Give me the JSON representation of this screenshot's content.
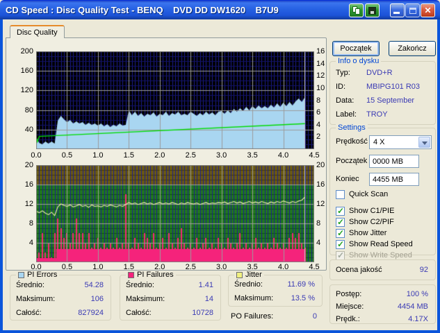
{
  "window": {
    "title": "CD Speed : Disc Quality Test - BENQ    DVD DD DW1620    B7U9"
  },
  "titlebar_icons": {
    "copy": "copy-icon",
    "save": "save-icon",
    "minimize": "minimize-icon",
    "maximize": "maximize-icon",
    "close": "close-icon"
  },
  "tab": {
    "label": "Disc Quality"
  },
  "actions": {
    "start_label": "Początek",
    "stop_label": "Zakończ"
  },
  "disc_info": {
    "title": "Info o dysku",
    "rows": [
      {
        "label": "Typ:",
        "value": "DVD+R"
      },
      {
        "label": "ID:",
        "value": "MBIPG101 R03"
      },
      {
        "label": "Data:",
        "value": "15 September"
      },
      {
        "label": "Label:",
        "value": "TROY"
      }
    ]
  },
  "settings": {
    "title": "Settings",
    "speed_label": "Prędkość",
    "speed_value": "4 X",
    "start_label": "Początek",
    "start_value": "0000 MB",
    "end_label": "Koniec",
    "end_value": "4455 MB",
    "checkboxes": [
      {
        "label": "Quick Scan",
        "checked": false,
        "enabled": true
      },
      {
        "label": "Show C1/PIE",
        "checked": true,
        "enabled": true
      },
      {
        "label": "Show C2/PIF",
        "checked": true,
        "enabled": true
      },
      {
        "label": "Show Jitter",
        "checked": true,
        "enabled": true
      },
      {
        "label": "Show Read Speed",
        "checked": true,
        "enabled": true
      },
      {
        "label": "Show Write Speed",
        "checked": true,
        "enabled": false
      }
    ]
  },
  "quality": {
    "label": "Ocena jakość",
    "value": "92"
  },
  "progress": {
    "rows": [
      {
        "label": "Postęp:",
        "value": "100 %"
      },
      {
        "label": "Miejsce:",
        "value": "4454 MB"
      },
      {
        "label": "Prędk.:",
        "value": "4.17X"
      }
    ]
  },
  "stats": {
    "pi_errors": {
      "title": "PI Errors",
      "swatch_color": "#A9D6F1",
      "rows": [
        {
          "label": "Średnio:",
          "value": "54.28"
        },
        {
          "label": "Maksimum:",
          "value": "106"
        },
        {
          "label": "Całość:",
          "value": "827924"
        }
      ]
    },
    "pi_failures": {
      "title": "PI Failures",
      "swatch_color": "#F5237B",
      "rows": [
        {
          "label": "Średnio:",
          "value": "1.41"
        },
        {
          "label": "Maksimum:",
          "value": "14"
        },
        {
          "label": "Całość:",
          "value": "10728"
        }
      ]
    },
    "jitter": {
      "title": "Jitter",
      "swatch_color": "#F0F080",
      "rows": [
        {
          "label": "Średnio:",
          "value": "11.69 %"
        },
        {
          "label": "Maksimum:",
          "value": "13.5 %"
        }
      ]
    },
    "po_failures": {
      "label": "PO Failures:",
      "value": "0"
    }
  },
  "chart_data": [
    {
      "type": "area",
      "name": "PI Errors / Read Speed",
      "xlim": [
        0,
        4.5
      ],
      "x_step": 0.05,
      "ylim_left": [
        0,
        200
      ],
      "ylim_right": [
        0,
        16
      ],
      "x_ticks": [
        "0.0",
        "0.5",
        "1.0",
        "1.5",
        "2.0",
        "2.5",
        "3.0",
        "3.5",
        "4.0",
        "4.5"
      ],
      "y_ticks_left": [
        "200",
        "160",
        "120",
        "80",
        "40"
      ],
      "y_ticks_right": [
        "16",
        "14",
        "12",
        "10",
        "8",
        "6",
        "4",
        "2"
      ],
      "bg": "#000000",
      "grid": {
        "minor_v": "#1C1C8E",
        "minor_h": "#12126A",
        "major": "#9C9C9C",
        "border": "#808080"
      },
      "data_end_x": 4.345,
      "series": [
        {
          "name": "PI Errors",
          "type": "area",
          "axis": "left",
          "color": "#A9D6F1",
          "values": [
            24,
            13,
            10,
            15,
            11,
            16,
            12,
            58,
            68,
            61,
            55,
            60,
            53,
            57,
            52,
            56,
            50,
            54,
            49,
            53,
            48,
            52,
            47,
            51,
            46,
            50,
            47,
            52,
            48,
            50,
            80,
            70,
            76,
            68,
            74,
            66,
            72,
            69,
            75,
            67,
            73,
            70,
            76,
            68,
            74,
            71,
            77,
            69,
            73,
            70,
            76,
            72,
            68,
            74,
            70,
            77,
            71,
            75,
            69,
            76,
            78,
            72,
            80,
            74,
            82,
            76,
            84,
            78,
            86,
            80,
            88,
            82,
            90,
            84,
            88,
            83,
            91,
            85,
            93,
            87,
            95,
            88,
            96,
            90,
            98,
            104,
            97,
            106
          ]
        },
        {
          "name": "Read Speed",
          "type": "line",
          "axis": "right",
          "color": "#00DC00",
          "x": [
            0.0,
            0.02,
            0.05,
            4.35
          ],
          "y": [
            2.05,
            1.2,
            2.08,
            4.17
          ]
        }
      ]
    },
    {
      "type": "bars+line",
      "name": "PI Failures / Jitter",
      "xlim": [
        0,
        4.5
      ],
      "x_step": 0.05,
      "ylim": [
        0,
        20
      ],
      "x_ticks": [
        "0.0",
        "0.5",
        "1.0",
        "1.5",
        "2.0",
        "2.5",
        "3.0",
        "3.5",
        "4.0",
        "4.5"
      ],
      "y_ticks_left": [
        "20",
        "16",
        "12",
        "8",
        "4"
      ],
      "y_ticks_right": [
        "20",
        "16",
        "12",
        "8",
        "4"
      ],
      "zones": [
        {
          "from": 16,
          "to": 20,
          "color": "#6B5A12"
        },
        {
          "from": 0,
          "to": 16,
          "color": "#20781E"
        }
      ],
      "grid": {
        "minor_v": "#1D1D92",
        "minor_h_green": "#0C5210",
        "minor_h_brown": "#453A06",
        "major": "#9C9C9C",
        "border": "#808080"
      },
      "data_end_x": 4.345,
      "series": [
        {
          "name": "PI Failures",
          "type": "bar",
          "color": "#F5237B",
          "base_band": 2.7,
          "base_band_low": 0.85,
          "base_split_x": 0.33,
          "values": [
            1,
            2,
            6,
            2,
            4,
            1,
            6,
            9,
            7,
            5,
            6,
            4,
            6,
            9,
            6,
            6,
            4,
            6,
            3,
            4,
            5,
            3,
            4,
            3,
            4,
            3,
            5,
            3,
            4,
            14,
            4,
            3,
            5,
            4,
            3,
            6,
            5,
            4,
            6,
            3,
            4,
            5,
            3,
            6,
            4,
            3,
            5,
            7,
            4,
            3,
            4,
            3,
            5,
            3,
            4,
            5,
            3,
            4,
            3,
            5,
            4,
            3,
            5,
            4,
            3,
            4,
            6,
            3,
            4,
            3,
            4,
            5,
            3,
            4,
            3,
            4,
            3,
            5,
            4,
            3,
            4,
            3,
            5,
            6,
            5,
            6,
            4,
            3
          ]
        },
        {
          "name": "Jitter",
          "type": "line",
          "color": "#F2F2B0",
          "values": [
            10.5,
            10.2,
            10.6,
            10.1,
            9.8,
            10.3,
            9.6,
            11.4,
            12.0,
            11.7,
            11.5,
            11.8,
            11.4,
            11.6,
            11.9,
            11.5,
            11.7,
            11.3,
            11.8,
            11.5,
            11.6,
            11.4,
            11.7,
            11.5,
            11.8,
            11.6,
            11.4,
            11.7,
            11.5,
            11.9,
            12.3,
            12.0,
            12.2,
            11.9,
            12.1,
            12.3,
            12.0,
            12.2,
            11.9,
            12.1,
            12.3,
            12.0,
            12.2,
            12.0,
            12.3,
            12.1,
            11.9,
            12.2,
            12.0,
            12.3,
            12.1,
            12.0,
            12.2,
            11.9,
            12.1,
            12.3,
            12.0,
            12.2,
            12.1,
            12.3,
            12.2,
            12.4,
            12.1,
            12.3,
            12.5,
            12.2,
            12.4,
            12.1,
            12.3,
            12.5,
            12.2,
            12.4,
            12.2,
            12.5,
            12.3,
            12.1,
            12.4,
            12.2,
            12.5,
            12.3,
            12.6,
            12.4,
            12.2,
            12.5,
            12.3,
            12.6,
            12.8,
            13.4
          ]
        }
      ]
    }
  ]
}
